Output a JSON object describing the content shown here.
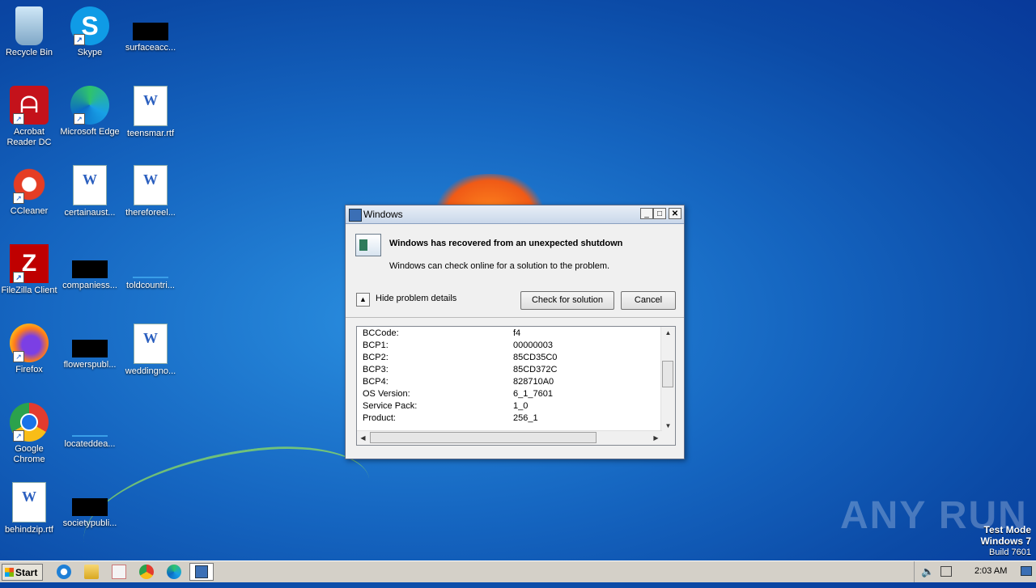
{
  "desktop": {
    "icons": [
      {
        "label": "Recycle Bin",
        "icon": "recycle-bin-icon"
      },
      {
        "label": "Skype",
        "icon": "skype-icon"
      },
      {
        "label": "surfaceacc...",
        "icon": "file-icon"
      },
      {
        "label": "Acrobat Reader DC",
        "icon": "acrobat-icon"
      },
      {
        "label": "Microsoft Edge",
        "icon": "edge-icon"
      },
      {
        "label": "teensmar.rtf",
        "icon": "word-doc-icon"
      },
      {
        "label": "CCleaner",
        "icon": "ccleaner-icon"
      },
      {
        "label": "certainaust...",
        "icon": "word-doc-icon"
      },
      {
        "label": "thereforeel...",
        "icon": "word-doc-icon"
      },
      {
        "label": "FileZilla Client",
        "icon": "filezilla-icon"
      },
      {
        "label": "companiess...",
        "icon": "file-icon"
      },
      {
        "label": "toldcountri...",
        "icon": "file-icon"
      },
      {
        "label": "Firefox",
        "icon": "firefox-icon"
      },
      {
        "label": "flowerspubl...",
        "icon": "file-icon"
      },
      {
        "label": "weddingno...",
        "icon": "word-doc-icon"
      },
      {
        "label": "Google Chrome",
        "icon": "chrome-icon"
      },
      {
        "label": "locateddea...",
        "icon": "file-icon"
      },
      {
        "label": "behindzip.rtf",
        "icon": "word-doc-icon"
      },
      {
        "label": "societypubli...",
        "icon": "file-icon"
      }
    ]
  },
  "dialog": {
    "title": "Windows",
    "heading": "Windows has recovered from an unexpected shutdown",
    "subtext": "Windows can check online for a solution to the problem.",
    "toggle_label": "Hide problem details",
    "check_button": "Check for solution",
    "cancel_button": "Cancel",
    "details": [
      {
        "key": "BCCode:",
        "value": "f4"
      },
      {
        "key": "BCP1:",
        "value": "00000003"
      },
      {
        "key": "BCP2:",
        "value": "85CD35C0"
      },
      {
        "key": "BCP3:",
        "value": "85CD372C"
      },
      {
        "key": "BCP4:",
        "value": "828710A0"
      },
      {
        "key": "OS Version:",
        "value": "6_1_7601"
      },
      {
        "key": "Service Pack:",
        "value": "1_0"
      },
      {
        "key": "Product:",
        "value": "256_1"
      }
    ]
  },
  "watermark": "ANY RUN",
  "test_mode": {
    "line1": "Test Mode",
    "line2": "Windows 7",
    "line3": "Build 7601"
  },
  "taskbar": {
    "start_label": "Start",
    "clock": "2:03 AM"
  }
}
